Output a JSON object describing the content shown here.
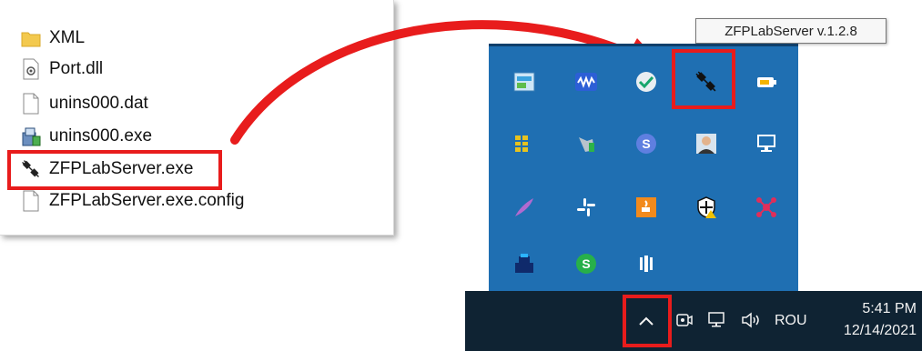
{
  "explorer": {
    "files": [
      {
        "name": "XML",
        "icon": "folder-icon"
      },
      {
        "name": "Port.dll",
        "icon": "dll-file-icon"
      },
      {
        "name": "unins000.dat",
        "icon": "blank-file-icon"
      },
      {
        "name": "unins000.exe",
        "icon": "installer-icon"
      },
      {
        "name": "ZFPLabServer.exe",
        "icon": "plug-icon"
      },
      {
        "name": "ZFPLabServer.exe.config",
        "icon": "blank-file-icon"
      }
    ]
  },
  "tooltip": {
    "text": "ZFPLabServer v.1.2.8"
  },
  "tray": {
    "icons": [
      "dashboard-app-icon",
      "waves-app-icon",
      "checkmark-shield-icon",
      "zfplab-plug-icon",
      "battery-monitor-icon",
      "yellow-grid-app-icon",
      "vpn-hand-icon",
      "skype-s-icon",
      "person-avatar-icon",
      "network-monitor-icon",
      "feather-app-icon",
      "slack-icon",
      "java-icon",
      "security-shield-warning-icon",
      "red-network-icon",
      "printer-app-icon",
      "green-dollar-icon",
      "barcode-app-icon"
    ]
  },
  "taskbar": {
    "language": "ROU",
    "time": "5:41 PM",
    "date": "12/14/2021",
    "icons": [
      "show-hidden-icons-chevron",
      "meeting-icon",
      "network-icon",
      "volume-icon"
    ]
  },
  "colors": {
    "highlight": "#e81c1c",
    "tray_bg": "#1f6fb2",
    "taskbar_bg": "#0f2333"
  }
}
